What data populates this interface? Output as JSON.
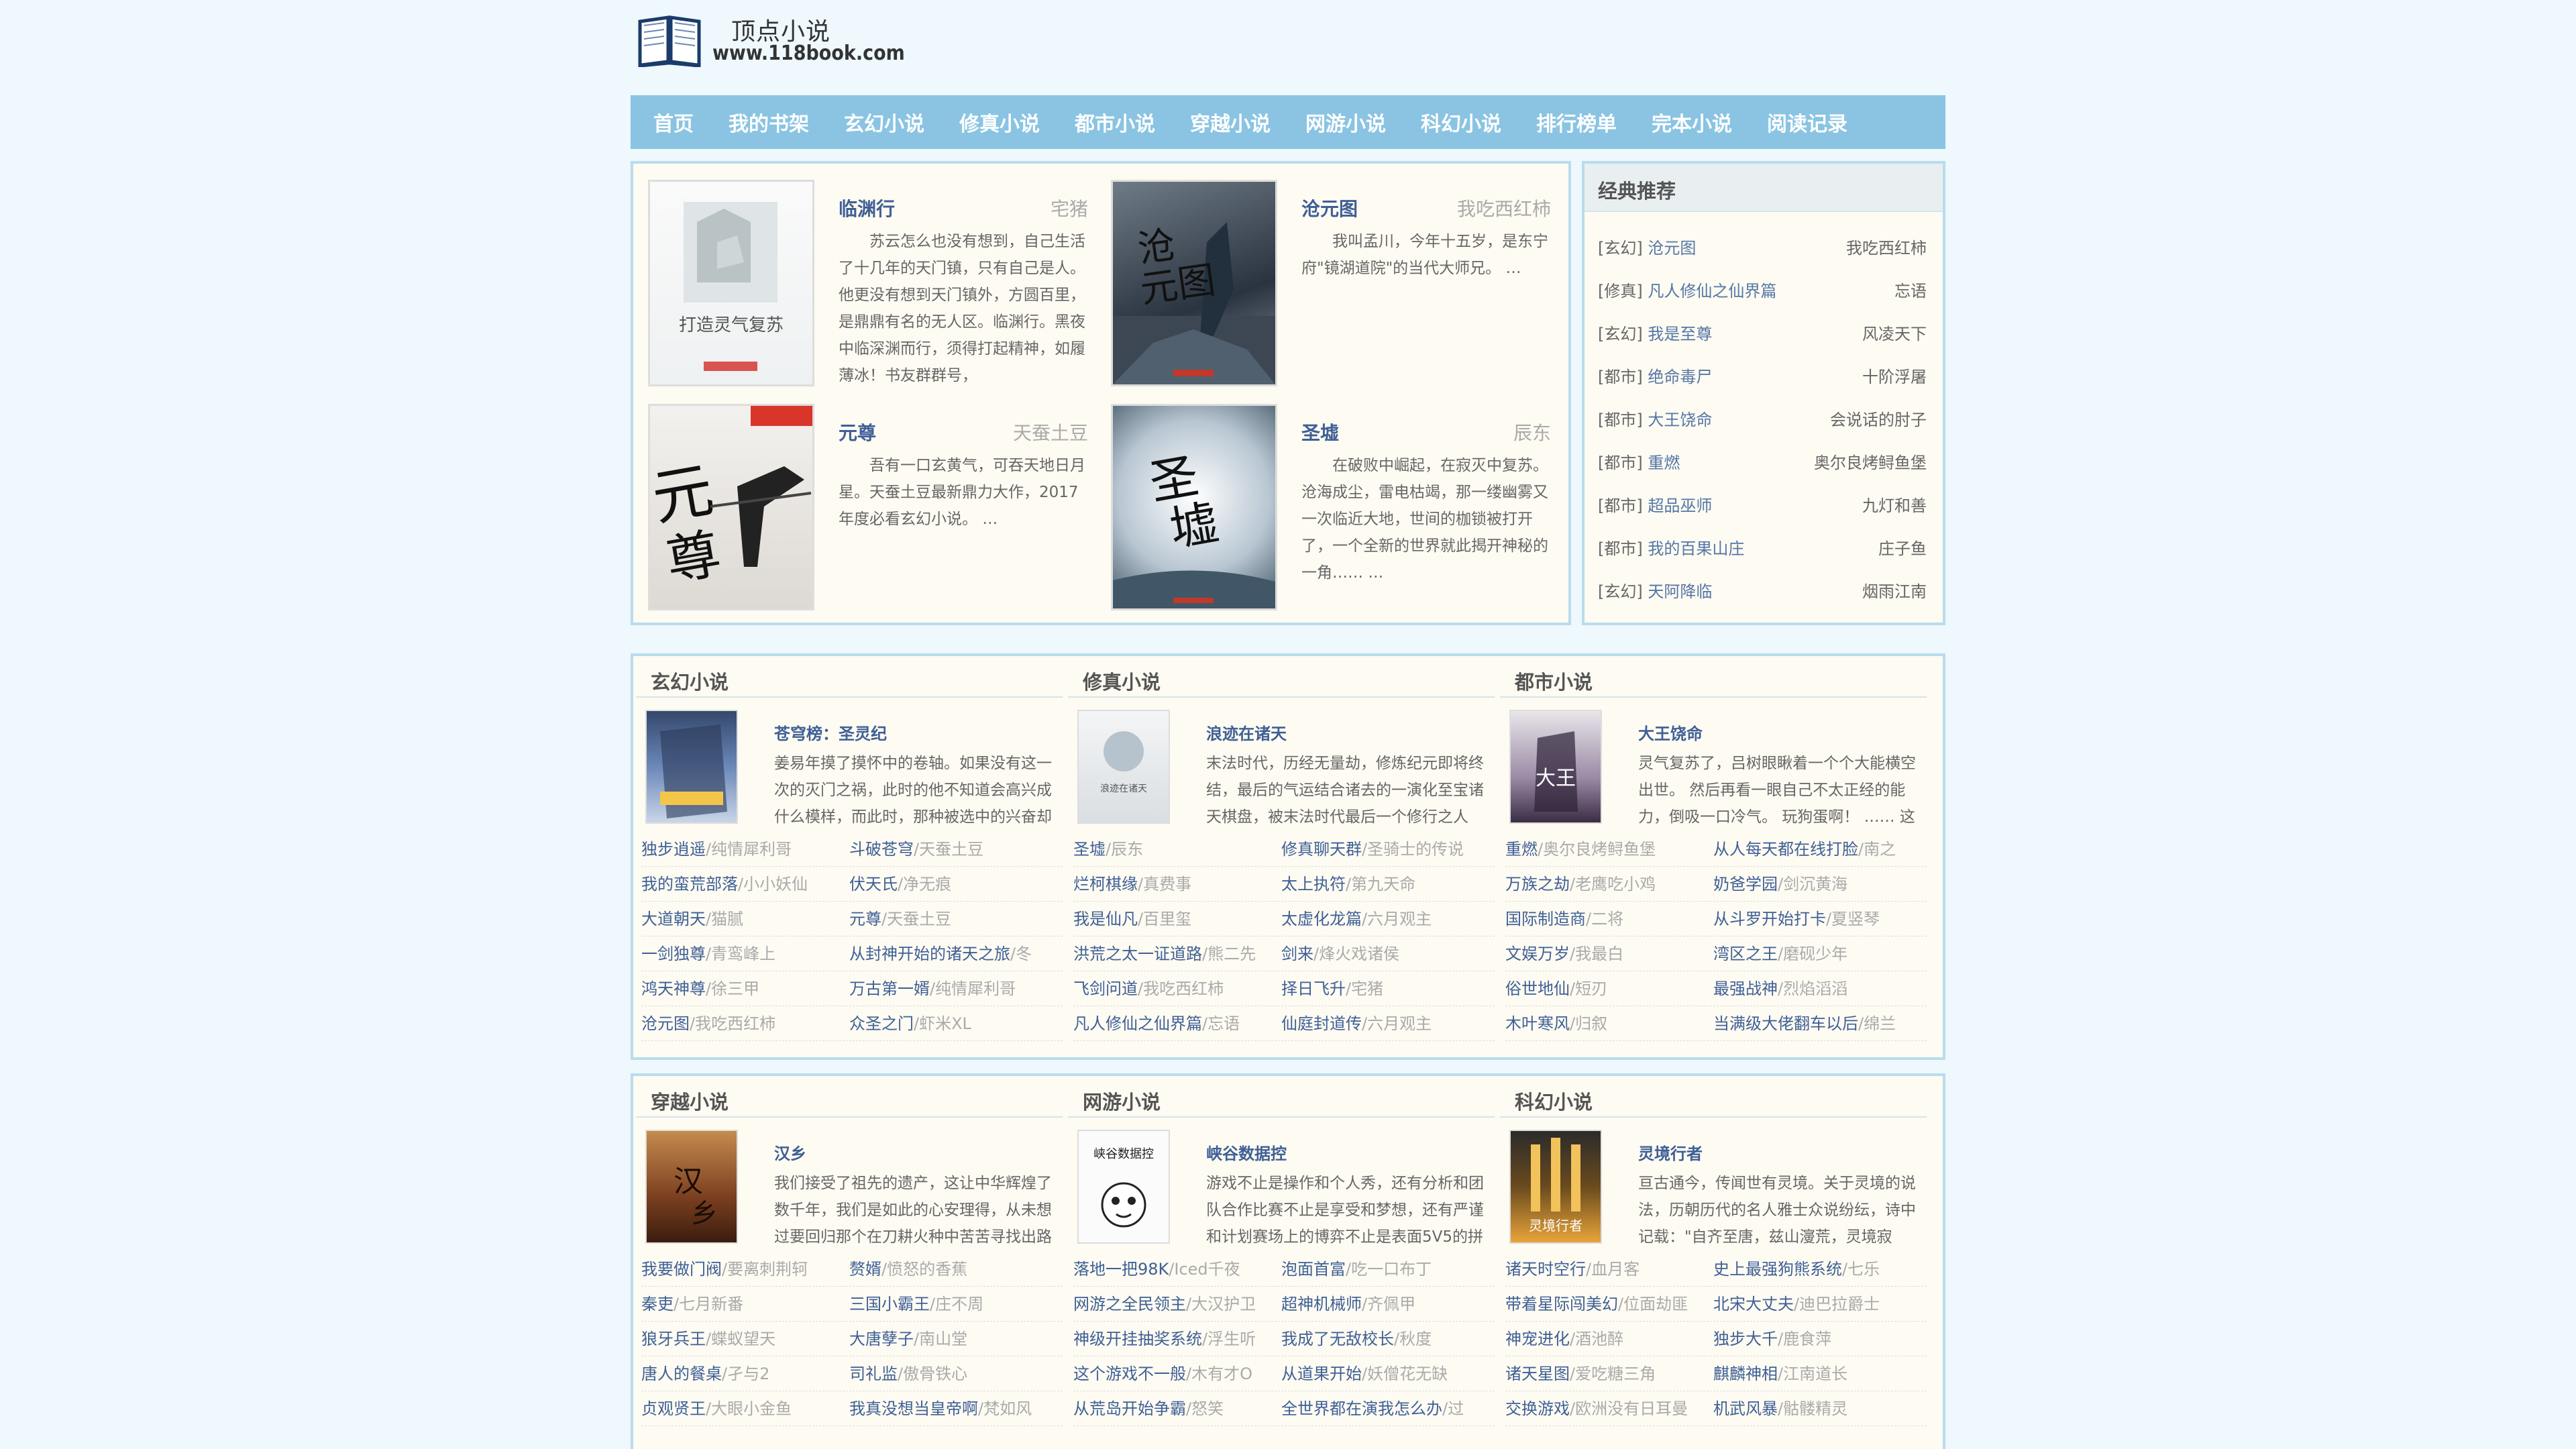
{
  "site": {
    "title": "顶点小说",
    "url": "www.118book.com"
  },
  "nav": [
    "首页",
    "我的书架",
    "玄幻小说",
    "修真小说",
    "都市小说",
    "穿越小说",
    "网游小说",
    "科幻小说",
    "排行榜单",
    "完本小说",
    "阅读记录"
  ],
  "featured": [
    {
      "title": "临渊行",
      "author": "宅猪",
      "desc": "苏云怎么也没有想到，自己生活了十几年的天门镇，只有自己是人。他更没有想到天门镇外，方圆百里，是鼎鼎有名的无人区。临渊行。黑夜中临深渊而行，须得打起精神，如履薄冰！书友群群号，",
      "cover_text": "打造灵气复苏"
    },
    {
      "title": "沧元图",
      "author": "我吃西红柿",
      "desc": "我叫孟川，今年十五岁，是东宁府\"镜湖道院\"的当代大师兄。 …",
      "cover_text": "沧元图"
    },
    {
      "title": "元尊",
      "author": "天蚕土豆",
      "desc": "吾有一口玄黄气，可吞天地日月星。天蚕土豆最新鼎力大作，2017年度必看玄幻小说。 …",
      "cover_text": "元尊"
    },
    {
      "title": "圣墟",
      "author": "辰东",
      "desc": "在破败中崛起，在寂灭中复苏。 沧海成尘，雷电枯竭，那一缕幽雾又一次临近大地，世间的枷锁被打开了，一个全新的世界就此揭开神秘的一角…… …",
      "cover_text": "圣墟"
    }
  ],
  "recommend": {
    "heading": "经典推荐",
    "items": [
      {
        "cat": "[玄幻]",
        "name": "沧元图",
        "author": "我吃西红柿"
      },
      {
        "cat": "[修真]",
        "name": "凡人修仙之仙界篇",
        "author": "忘语"
      },
      {
        "cat": "[玄幻]",
        "name": "我是至尊",
        "author": "风凌天下"
      },
      {
        "cat": "[都市]",
        "name": "绝命毒尸",
        "author": "十阶浮屠"
      },
      {
        "cat": "[都市]",
        "name": "大王饶命",
        "author": "会说话的肘子"
      },
      {
        "cat": "[都市]",
        "name": "重燃",
        "author": "奥尔良烤鲟鱼堡"
      },
      {
        "cat": "[都市]",
        "name": "超品巫师",
        "author": "九灯和善"
      },
      {
        "cat": "[都市]",
        "name": "我的百果山庄",
        "author": "庄子鱼"
      },
      {
        "cat": "[玄幻]",
        "name": "天阿降临",
        "author": "烟雨江南"
      }
    ]
  },
  "categories": [
    {
      "name": "玄幻小说",
      "top": {
        "title": "苍穹榜：圣灵纪",
        "desc": "姜易年摸了摸怀中的卷轴。如果没有这一次的灭门之祸，此时的他不知道会高兴成什么模样，而此时，那种被选中的兴奋却"
      },
      "list": [
        [
          [
            "独步逍遥",
            "/纯情犀利哥"
          ],
          [
            "斗破苍穹",
            "/天蚕土豆"
          ]
        ],
        [
          [
            "我的蛮荒部落",
            "/小小妖仙"
          ],
          [
            "伏天氏",
            "/净无痕"
          ]
        ],
        [
          [
            "大道朝天",
            "/猫腻"
          ],
          [
            "元尊",
            "/天蚕土豆"
          ]
        ],
        [
          [
            "一剑独尊",
            "/青鸾峰上"
          ],
          [
            "从封神开始的诸天之旅",
            "/冬"
          ]
        ],
        [
          [
            "鸿天神尊",
            "/徐三甲"
          ],
          [
            "万古第一婿",
            "/纯情犀利哥"
          ]
        ],
        [
          [
            "沧元图",
            "/我吃西红柿"
          ],
          [
            "众圣之门",
            "/虾米XL"
          ]
        ]
      ]
    },
    {
      "name": "修真小说",
      "top": {
        "title": "浪迹在诸天",
        "desc": "末法时代，历经无量劫，修炼纪元即将终结，最后的气运结合诸去的一演化至宝诸天棋盘，被末法时代最后一个修行之人"
      },
      "list": [
        [
          [
            "圣墟",
            "/辰东"
          ],
          [
            "修真聊天群",
            "/圣骑士的传说"
          ]
        ],
        [
          [
            "烂柯棋缘",
            "/真费事"
          ],
          [
            "太上执符",
            "/第九天命"
          ]
        ],
        [
          [
            "我是仙凡",
            "/百里玺"
          ],
          [
            "太虚化龙篇",
            "/六月观主"
          ]
        ],
        [
          [
            "洪荒之太一证道路",
            "/熊二先"
          ],
          [
            "剑来",
            "/烽火戏诸侯"
          ]
        ],
        [
          [
            "飞剑问道",
            "/我吃西红柿"
          ],
          [
            "择日飞升",
            "/宅猪"
          ]
        ],
        [
          [
            "凡人修仙之仙界篇",
            "/忘语"
          ],
          [
            "仙庭封道传",
            "/六月观主"
          ]
        ]
      ]
    },
    {
      "name": "都市小说",
      "top": {
        "title": "大王饶命",
        "desc": "灵气复苏了，吕树眼瞅着一个个大能横空出世。 然后再看一眼自己不太正经的能力，倒吸一口冷气。 玩狗蛋啊！ …… 这"
      },
      "list": [
        [
          [
            "重燃",
            "/奥尔良烤鲟鱼堡"
          ],
          [
            "从人每天都在线打脸",
            "/南之"
          ]
        ],
        [
          [
            "万族之劫",
            "/老鹰吃小鸡"
          ],
          [
            "奶爸学园",
            "/剑沉黄海"
          ]
        ],
        [
          [
            "国际制造商",
            "/二将"
          ],
          [
            "从斗罗开始打卡",
            "/夏竖琴"
          ]
        ],
        [
          [
            "文娱万岁",
            "/我最白"
          ],
          [
            "湾区之王",
            "/磨砚少年"
          ]
        ],
        [
          [
            "俗世地仙",
            "/短刃"
          ],
          [
            "最强战神",
            "/烈焰滔滔"
          ]
        ],
        [
          [
            "木叶寒风",
            "/归叙"
          ],
          [
            "当满级大佬翻车以后",
            "/绵兰"
          ]
        ]
      ]
    },
    {
      "name": "穿越小说",
      "top": {
        "title": "汉乡",
        "desc": "我们接受了祖先的遗产，这让中华辉煌了数千年，我们是如此的心安理得，从未想过要回归那个在刀耕火种中苦苦寻找出路"
      },
      "list": [
        [
          [
            "我要做门阀",
            "/要离刺荆轲"
          ],
          [
            "赘婿",
            "/愤怒的香蕉"
          ]
        ],
        [
          [
            "秦吏",
            "/七月新番"
          ],
          [
            "三国小霸王",
            "/庄不周"
          ]
        ],
        [
          [
            "狼牙兵王",
            "/蝶蚁望天"
          ],
          [
            "大唐孽子",
            "/南山堂"
          ]
        ],
        [
          [
            "唐人的餐桌",
            "/孑与2"
          ],
          [
            "司礼监",
            "/傲骨铁心"
          ]
        ],
        [
          [
            "贞观贤王",
            "/大眼小金鱼"
          ],
          [
            "我真没想当皇帝啊",
            "/梵如风"
          ]
        ]
      ]
    },
    {
      "name": "网游小说",
      "top": {
        "title": "峡谷数据控",
        "desc": "游戏不止是操作和个人秀，还有分析和团队合作比赛不止是享受和梦想，还有严谨和计划赛场上的博弈不止是表面5V5的拼"
      },
      "list": [
        [
          [
            "落地一把98K",
            "/Iced千夜"
          ],
          [
            "泡面首富",
            "/吃一口布丁"
          ]
        ],
        [
          [
            "网游之全民领主",
            "/大汉护卫"
          ],
          [
            "超神机械师",
            "/齐佩甲"
          ]
        ],
        [
          [
            "神级开挂抽奖系统",
            "/浮生听"
          ],
          [
            "我成了无敌校长",
            "/秋度"
          ]
        ],
        [
          [
            "这个游戏不一般",
            "/木有才O"
          ],
          [
            "从道果开始",
            "/妖僧花无缺"
          ]
        ],
        [
          [
            "从荒岛开始争霸",
            "/怒笑"
          ],
          [
            "全世界都在演我怎么办",
            "/过"
          ]
        ]
      ]
    },
    {
      "name": "科幻小说",
      "top": {
        "title": "灵境行者",
        "desc": "亘古通今，传闻世有灵境。关于灵境的说法，历朝历代的名人雅士众说纷纭，诗中记载：\"自齐至唐，兹山濅荒，灵境寂"
      },
      "list": [
        [
          [
            "诸天时空行",
            "/血月客"
          ],
          [
            "史上最强狗熊系统",
            "/七乐"
          ]
        ],
        [
          [
            "带着星际闯美幻",
            "/位面劫匪"
          ],
          [
            "北宋大丈夫",
            "/迪巴拉爵士"
          ]
        ],
        [
          [
            "神宠进化",
            "/酒池醉"
          ],
          [
            "独步大千",
            "/鹿食萍"
          ]
        ],
        [
          [
            "诸天星图",
            "/爱吃糖三角"
          ],
          [
            "麒麟神相",
            "/江南道长"
          ]
        ],
        [
          [
            "交换游戏",
            "/欧洲没有日耳曼"
          ],
          [
            "机武风暴",
            "/骷髅精灵"
          ]
        ]
      ]
    }
  ]
}
